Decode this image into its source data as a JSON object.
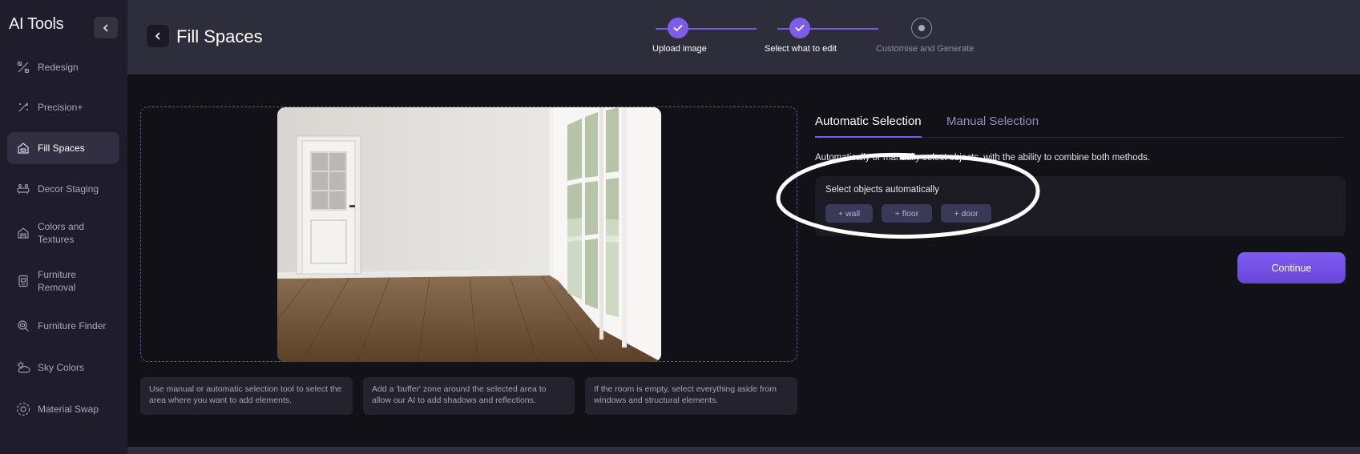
{
  "sidebar": {
    "brand": "AI Tools",
    "items": [
      {
        "label": "Redesign",
        "icon": "redesign-icon"
      },
      {
        "label": "Precision+",
        "icon": "precision-icon"
      },
      {
        "label": "Fill Spaces",
        "icon": "fill-spaces-icon",
        "active": true
      },
      {
        "label": "Decor Staging",
        "icon": "decor-staging-icon"
      },
      {
        "label": "Colors and Textures",
        "icon": "colors-textures-icon"
      },
      {
        "label": "Furniture Removal",
        "icon": "furniture-removal-icon"
      },
      {
        "label": "Furniture Finder",
        "icon": "furniture-finder-icon"
      },
      {
        "label": "Sky Colors",
        "icon": "sky-colors-icon"
      },
      {
        "label": "Material Swap",
        "icon": "material-swap-icon"
      }
    ]
  },
  "header": {
    "title": "Fill Spaces",
    "steps": [
      {
        "label": "Upload image",
        "status": "done"
      },
      {
        "label": "Select what to edit",
        "status": "done"
      },
      {
        "label": "Customise and Generate",
        "status": "current"
      }
    ]
  },
  "tips": [
    "Use manual or automatic selection tool to select the area where you want to add elements.",
    "Add a 'buffer' zone around the selected area to allow our AI to add shadows and reflections.",
    "If the room is empty, select everything aside from windows and structural elements."
  ],
  "panel": {
    "tabs": [
      {
        "label": "Automatic Selection",
        "active": true
      },
      {
        "label": "Manual Selection",
        "active": false
      }
    ],
    "description": "Automatically or manually select objects, with the ability to combine both methods.",
    "auto_title": "Select objects automatically",
    "chips": [
      "+ wall",
      "+ floor",
      "+ door"
    ],
    "continue_label": "Continue"
  },
  "colors": {
    "accent": "#7d5ce8",
    "sidebar_bg": "#1f1d2b",
    "header_bg": "#2d2d3c",
    "page_bg": "#121118"
  }
}
